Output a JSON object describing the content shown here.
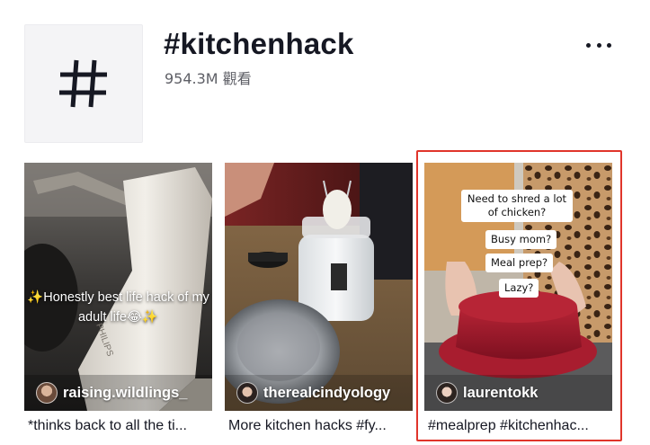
{
  "header": {
    "hashtag_symbol": "#",
    "title": "#kitchenhack",
    "views": "954.3M 觀看",
    "more_icon": "more-horizontal-icon"
  },
  "videos": [
    {
      "overlay": "✨Honestly best life hack of my adult life😂✨",
      "author": "raising.wildlings_",
      "caption": "*thinks back to all the ti..."
    },
    {
      "author": "therealcindyology",
      "caption": "More kitchen hacks #fy..."
    },
    {
      "bubbles": [
        "Need to shred a lot of chicken?",
        "Busy mom?",
        "Meal prep?",
        "Lazy?"
      ],
      "author": "laurentokk",
      "caption": "#mealprep #kitchenhac..."
    }
  ],
  "colors": {
    "highlight": "#e0352b",
    "text_primary": "#161823",
    "text_secondary": "#5e5f66"
  }
}
